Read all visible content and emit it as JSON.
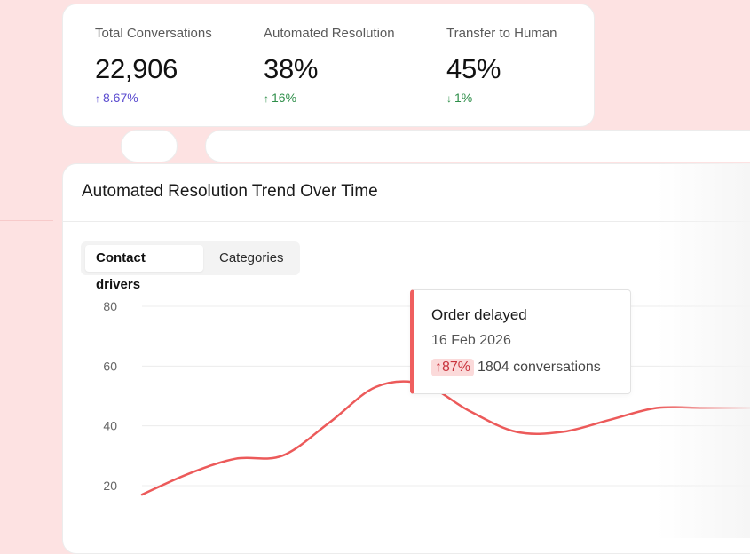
{
  "stats": [
    {
      "label": "Total Conversations",
      "value": "22,906",
      "delta": "8.67%",
      "direction": "up",
      "color": "#5a4bcf"
    },
    {
      "label": "Automated Resolution",
      "value": "38%",
      "delta": "16%",
      "direction": "up",
      "color": "#2f8f4a"
    },
    {
      "label": "Transfer to Human",
      "value": "45%",
      "delta": "1%",
      "direction": "down",
      "color": "#2f8f4a"
    }
  ],
  "arrows": {
    "up": "↑",
    "down": "↓"
  },
  "panel": {
    "title": "Automated Resolution Trend Over Time",
    "tabs": [
      {
        "label": "Contact drivers",
        "active": true
      },
      {
        "label": "Categories",
        "active": false
      }
    ]
  },
  "chart_data": {
    "type": "line",
    "y_ticks": [
      80,
      60,
      40,
      20
    ],
    "ylim": [
      15,
      85
    ],
    "series": [
      {
        "color": "#ec5a5a",
        "points": [
          [
            0,
            17
          ],
          [
            1,
            24
          ],
          [
            2,
            29
          ],
          [
            3,
            30
          ],
          [
            4,
            41
          ],
          [
            5,
            53
          ],
          [
            6,
            54
          ],
          [
            7,
            45
          ],
          [
            8,
            38
          ],
          [
            9,
            38
          ],
          [
            10,
            42
          ],
          [
            11,
            46
          ],
          [
            12,
            46
          ],
          [
            13,
            46
          ]
        ]
      }
    ]
  },
  "tooltip": {
    "title": "Order delayed",
    "date": "16 Feb 2026",
    "badge": "87%",
    "detail": "1804 conversations",
    "accent": "#ef5f5f"
  }
}
